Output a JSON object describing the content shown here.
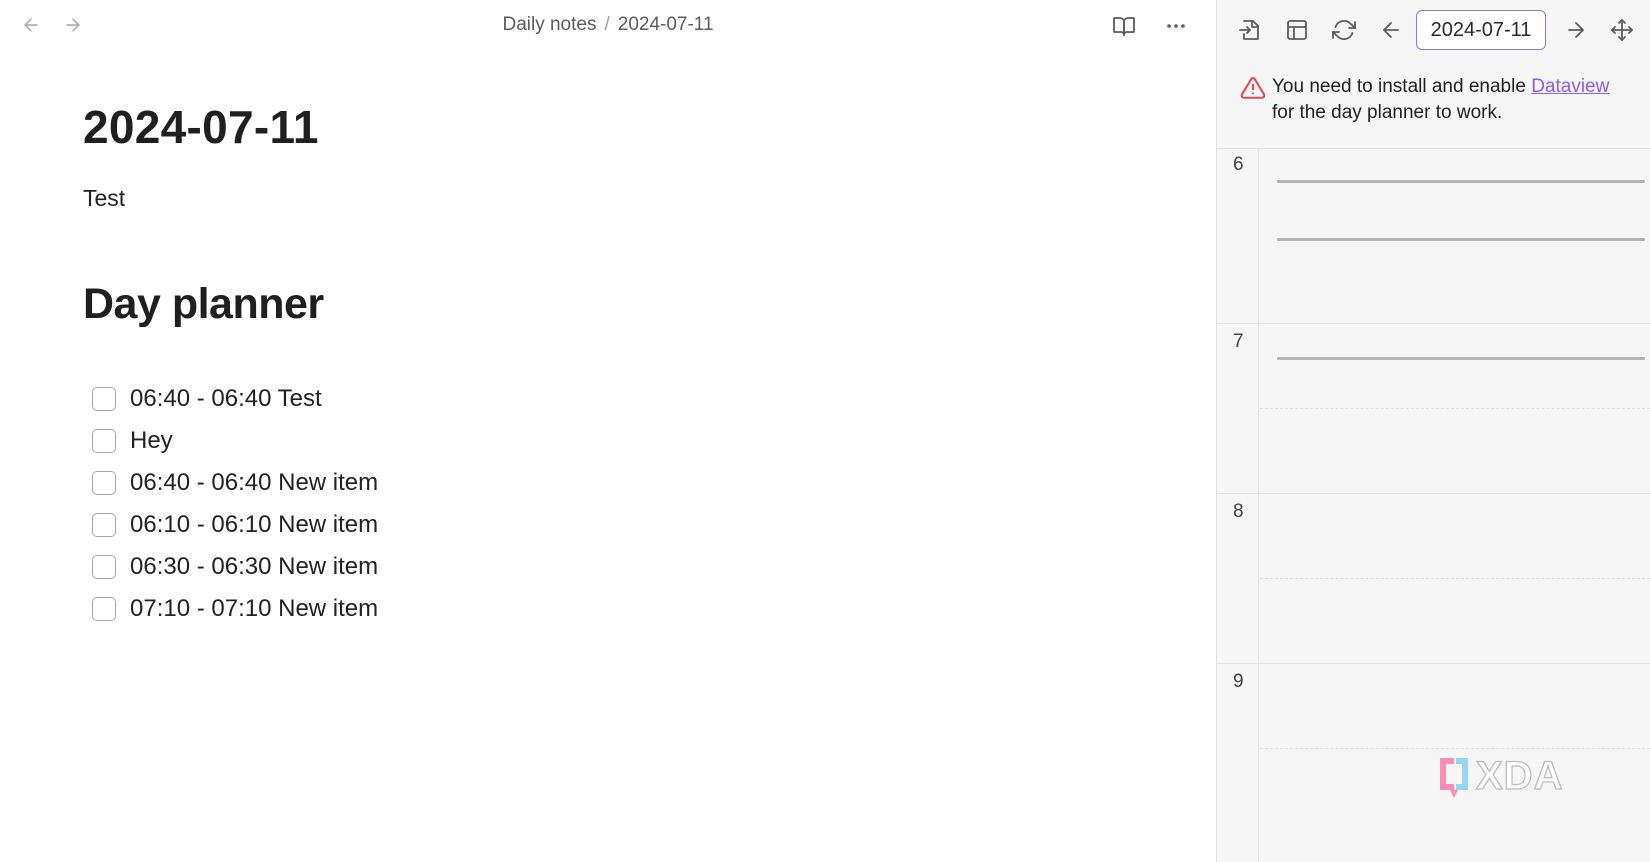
{
  "editor": {
    "breadcrumb": {
      "folder": "Daily notes",
      "separator": "/",
      "file": "2024-07-11"
    },
    "note": {
      "title": "2024-07-11",
      "paragraph": "Test",
      "section_heading": "Day planner",
      "tasks": [
        {
          "text": "06:40 - 06:40 Test",
          "checked": false
        },
        {
          "text": "Hey",
          "checked": false
        },
        {
          "text": "06:40 - 06:40 New item",
          "checked": false
        },
        {
          "text": "06:10 - 06:10 New item",
          "checked": false
        },
        {
          "text": "06:30 - 06:30 New item",
          "checked": false
        },
        {
          "text": "07:10 - 07:10 New item",
          "checked": false
        }
      ]
    },
    "icons": {
      "back": "arrow-left-icon",
      "forward": "arrow-right-icon",
      "reading_view": "book-open-icon",
      "more": "more-horizontal-icon"
    }
  },
  "planner": {
    "toolbar": {
      "date": "2024-07-11",
      "icons": [
        "open-note-icon",
        "layout-icon",
        "refresh-icon",
        "arrow-left-icon",
        "arrow-right-icon",
        "move-icon"
      ]
    },
    "warning": {
      "before": "You need to install and enable ",
      "link": "Dataview",
      "after": "for the day planner to work."
    },
    "hours": [
      "6",
      "7",
      "8",
      "9"
    ],
    "accent_color": "#8b5cf6",
    "warning_color": "#e5484d"
  },
  "watermark": {
    "text": "XDA"
  }
}
